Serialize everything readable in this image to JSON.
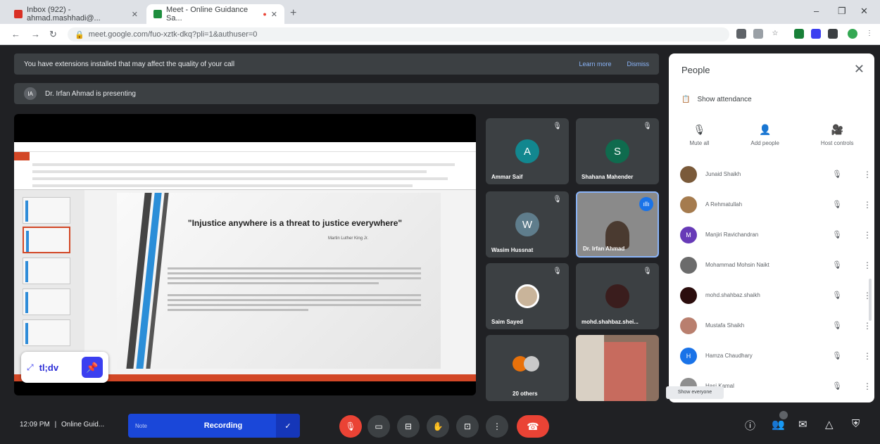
{
  "browser": {
    "tabs": [
      {
        "title": "Inbox (922) - ahmad.mashhadi@...",
        "color": "#d93025",
        "active": false
      },
      {
        "title": "Meet - Online Guidance Sa...",
        "color": "#1e8e3e",
        "active": true
      }
    ],
    "url": "meet.google.com/fuo-xztk-dkq?pli=1&authuser=0",
    "nav": {
      "back": "←",
      "forward": "→",
      "reload": "↻",
      "new_tab": "+"
    },
    "window": {
      "min": "–",
      "max": "❐",
      "close": "✕"
    }
  },
  "banner": {
    "text": "You have extensions installed that may affect the quality of your call",
    "learn_more": "Learn more",
    "dismiss": "Dismiss"
  },
  "presenting": {
    "initials": "IA",
    "text": "Dr. Irfan Ahmad is presenting"
  },
  "slide": {
    "quote": "\"Injustice anywhere is a threat to justice everywhere\"",
    "author": "Martin Luther King Jr."
  },
  "tldv": {
    "brand": "tl;dv",
    "pin": "📌"
  },
  "tiles": [
    {
      "name": "Ammar Saif",
      "initial": "A",
      "color": "#12878f"
    },
    {
      "name": "Shahana Mahender",
      "initial": "S",
      "color": "#0f6b4e"
    },
    {
      "name": "Wasim Hussnat",
      "initial": "W",
      "color": "#5f7d8c"
    },
    {
      "name": "Dr. Irfan Ahmad",
      "initial": "",
      "color": "#8a8a8a"
    },
    {
      "name": "Saim Sayed",
      "initial": "",
      "color": "#c9b49a"
    },
    {
      "name": "mohd.shahbaz.shei...",
      "initial": "",
      "color": "#3a1d1d"
    },
    {
      "name": "20 others",
      "initial": "",
      "color": "#e8710a"
    },
    {
      "name": "",
      "initial": "",
      "color": "#8c7060"
    }
  ],
  "panel": {
    "title": "People",
    "close": "✕",
    "show_attendance": "Show attendance",
    "actions": [
      {
        "label": "Mute all",
        "icon": "🎙"
      },
      {
        "label": "Add people",
        "icon": "👤"
      },
      {
        "label": "Host controls",
        "icon": "🎥"
      }
    ],
    "people": [
      {
        "name": "Junaid Shaikh",
        "color": "#7a5a3a",
        "initial": ""
      },
      {
        "name": "A Rehmatullah",
        "color": "#a57b4e",
        "initial": ""
      },
      {
        "name": "Manjiri Ravichandran",
        "color": "#673ab7",
        "initial": "M"
      },
      {
        "name": "Mohammad Mohsin Naikt",
        "color": "#6b6b6b",
        "initial": ""
      },
      {
        "name": "mohd.shahbaz.shaikh",
        "color": "#2b0d0d",
        "initial": ""
      },
      {
        "name": "Mustafa Shaikh",
        "color": "#b97f6e",
        "initial": ""
      },
      {
        "name": "Hamza Chaudhary",
        "color": "#1a73e8",
        "initial": "H"
      },
      {
        "name": "Hasi Kamal",
        "color": "#8e8e8e",
        "initial": ""
      }
    ]
  },
  "bottom": {
    "time": "12:09 PM",
    "meeting": "Online Guid...",
    "rec_left": "Note",
    "recording": "Recording",
    "check": "✓",
    "tooltip": "Show everyone"
  }
}
